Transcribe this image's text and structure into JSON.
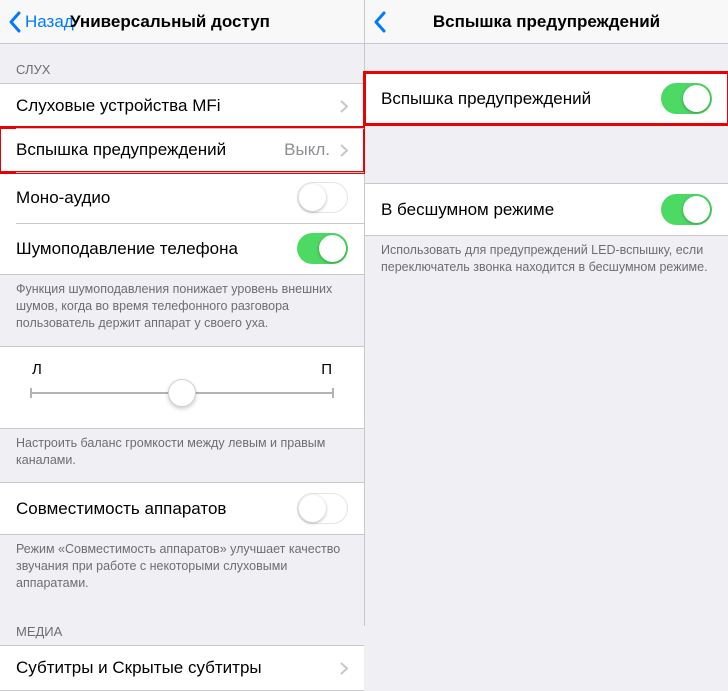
{
  "left": {
    "nav": {
      "back": "Назад",
      "title": "Универсальный доступ"
    },
    "section_hearing": "СЛУХ",
    "rows": {
      "mfi": "Слуховые устройства MFi",
      "flash": {
        "label": "Вспышка предупреждений",
        "value": "Выкл."
      },
      "mono": "Моно-аудио",
      "noise": "Шумоподавление телефона"
    },
    "footer_noise": "Функция шумоподавления понижает уровень внешних шумов, когда во время телефонного разговора пользователь держит аппарат у своего уха.",
    "slider": {
      "left": "Л",
      "right": "П"
    },
    "footer_balance": "Настроить баланс громкости между левым и правым каналами.",
    "compat": "Совместимость аппаратов",
    "footer_compat": "Режим «Совместимость аппаратов» улучшает качество звучания при работе с некоторыми слуховыми аппаратами.",
    "section_media": "МЕДИА",
    "subtitles": "Субтитры и Скрытые субтитры"
  },
  "right": {
    "nav": {
      "title": "Вспышка предупреждений"
    },
    "rows": {
      "flash": "Вспышка предупреждений",
      "silent": "В бесшумном режиме"
    },
    "footer_silent": "Использовать для предупреждений LED-вспышку, если переключатель звонка находится в бесшумном режиме."
  }
}
